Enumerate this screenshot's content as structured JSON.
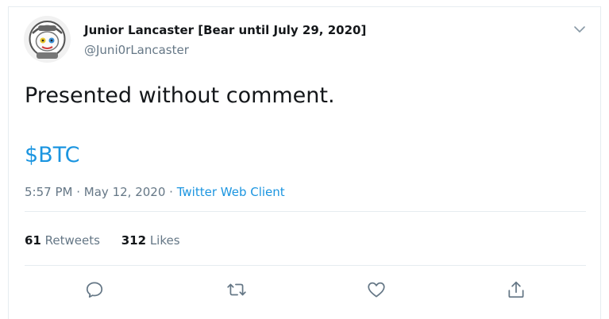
{
  "author": {
    "display_name": "Junior Lancaster [Bear until July 29, 2020]",
    "handle": "@Juni0rLancaster",
    "avatar_icon": "astronaut-avatar"
  },
  "tweet": {
    "text": "Presented without comment.",
    "cashtag": "$BTC",
    "time": "5:57 PM",
    "date": "May 12, 2020",
    "source": "Twitter Web Client",
    "separator": "·"
  },
  "stats": {
    "retweets_count": "61",
    "retweets_label": "Retweets",
    "likes_count": "312",
    "likes_label": "Likes"
  },
  "actions": {
    "reply_icon": "reply-icon",
    "retweet_icon": "retweet-icon",
    "like_icon": "heart-icon",
    "share_icon": "share-icon"
  },
  "colors": {
    "link": "#1b95e0",
    "muted": "#657786",
    "text": "#14171a",
    "border": "#e6ecf0"
  }
}
